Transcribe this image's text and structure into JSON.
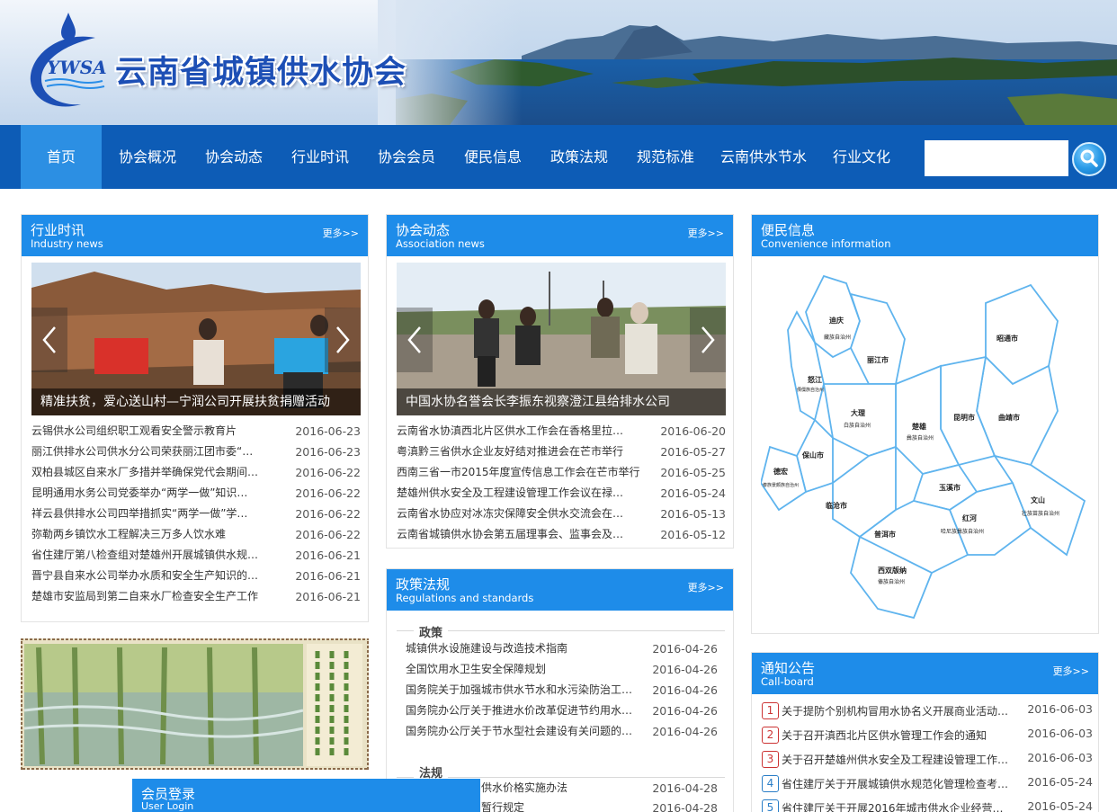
{
  "header": {
    "logo_text": "YWSA",
    "site_title": "云南省城镇供水协会"
  },
  "nav": {
    "items": [
      "首页",
      "协会概况",
      "协会动态",
      "行业时讯",
      "协会会员",
      "便民信息",
      "政策法规",
      "规范标准",
      "云南供水节水",
      "行业文化"
    ],
    "search_placeholder": ""
  },
  "industry_news": {
    "title": "行业时讯",
    "subtitle": "Industry news",
    "more": "更多>>",
    "slide_caption": "精准扶贫，爱心送山村—宁润公司开展扶贫捐赠活动",
    "items": [
      {
        "text": "云锡供水公司组织职工观看安全警示教育片",
        "date": "2016-06-23"
      },
      {
        "text": "丽江供排水公司供水分公司荣获丽江团市委“…",
        "date": "2016-06-23"
      },
      {
        "text": "双柏县城区自来水厂多措并举确保党代会期间…",
        "date": "2016-06-22"
      },
      {
        "text": "昆明通用水务公司党委举办“两学一做”知识…",
        "date": "2016-06-22"
      },
      {
        "text": "祥云县供排水公司四举措抓实“两学一做”学…",
        "date": "2016-06-22"
      },
      {
        "text": "弥勒两乡镇饮水工程解决三万多人饮水难",
        "date": "2016-06-22"
      },
      {
        "text": "省住建厅第八检查组对楚雄州开展城镇供水规…",
        "date": "2016-06-21"
      },
      {
        "text": "晋宁县自来水公司举办水质和安全生产知识的…",
        "date": "2016-06-21"
      },
      {
        "text": "楚雄市安监局到第二自来水厂检查安全生产工作",
        "date": "2016-06-21"
      }
    ]
  },
  "association_news": {
    "title": "协会动态",
    "subtitle": "Association news",
    "more": "更多>>",
    "slide_caption": "中国水协名誉会长李振东视察澄江县给排水公司",
    "items": [
      {
        "text": "云南省水协滇西北片区供水工作会在香格里拉…",
        "date": "2016-06-20"
      },
      {
        "text": "粤滇黔三省供水企业友好结对推进会在芒市举行",
        "date": "2016-05-27"
      },
      {
        "text": "西南三省一市2015年度宣传信息工作会在芒市举行",
        "date": "2016-05-25"
      },
      {
        "text": "楚雄州供水安全及工程建设管理工作会议在禄…",
        "date": "2016-05-24"
      },
      {
        "text": "云南省水协应对冰冻灾保障安全供水交流会在…",
        "date": "2016-05-13"
      },
      {
        "text": "云南省城镇供水协会第五届理事会、监事会及…",
        "date": "2016-05-12"
      }
    ]
  },
  "convenience": {
    "title": "便民信息",
    "subtitle": "Convenience information",
    "map_labels": [
      "迪庆",
      "藏族自治州",
      "丽江市",
      "怒江",
      "傈僳族自治州",
      "大理",
      "白族自治州",
      "楚雄",
      "彝族自治州",
      "昆明市",
      "曲靖市",
      "昭通市",
      "保山市",
      "德宏",
      "傣族景颇族自治州",
      "临沧市",
      "玉溪市",
      "普洱市",
      "红河",
      "哈尼族彝族自治州",
      "文山",
      "壮族苗族自治州",
      "西双版纳",
      "傣族自治州"
    ]
  },
  "policy": {
    "title": "政策法规",
    "subtitle": "Regulations and standards",
    "more": "更多>>",
    "policy_head": "政策",
    "policy_items": [
      {
        "text": "城镇供水设施建设与改造技术指南",
        "date": "2016-04-26"
      },
      {
        "text": "全国饮用水卫生安全保障规划",
        "date": "2016-04-26"
      },
      {
        "text": "国务院关于加强城市供水节水和水污染防治工…",
        "date": "2016-04-26"
      },
      {
        "text": "国务院办公厅关于推进水价改革促进节约用水…",
        "date": "2016-04-26"
      },
      {
        "text": "国务院办公厅关于节水型社会建设有关问题的…",
        "date": "2016-04-26"
      }
    ],
    "law_head": "法规",
    "law_items": [
      {
        "text": "供水价格实施办法",
        "date": "2016-04-28"
      },
      {
        "text": "暂行规定",
        "date": "2016-04-28"
      }
    ]
  },
  "notice": {
    "title": "通知公告",
    "subtitle": "Call-board",
    "more": "更多>>",
    "items": [
      {
        "num": "1",
        "text": "关于提防个别机构冒用水协名义开展商业活动…",
        "date": "2016-06-03"
      },
      {
        "num": "2",
        "text": "关于召开滇西北片区供水管理工作会的通知",
        "date": "2016-06-03"
      },
      {
        "num": "3",
        "text": "关于召开楚雄州供水安全及工程建设管理工作…",
        "date": "2016-06-03"
      },
      {
        "num": "4",
        "text": "省住建厅关于开展城镇供水规范化管理检查考…",
        "date": "2016-05-24"
      },
      {
        "num": "5",
        "text": "省住建厅关于开展2016年城市供水企业经营许…",
        "date": "2016-05-24"
      }
    ]
  },
  "login": {
    "title": "会员登录",
    "subtitle": "User Login"
  },
  "colors": {
    "nav_bg": "#0d5cb6",
    "nav_active": "#2c8fe3",
    "panel_head": "#1e8ce9",
    "title_blue": "#1d4fb5"
  }
}
